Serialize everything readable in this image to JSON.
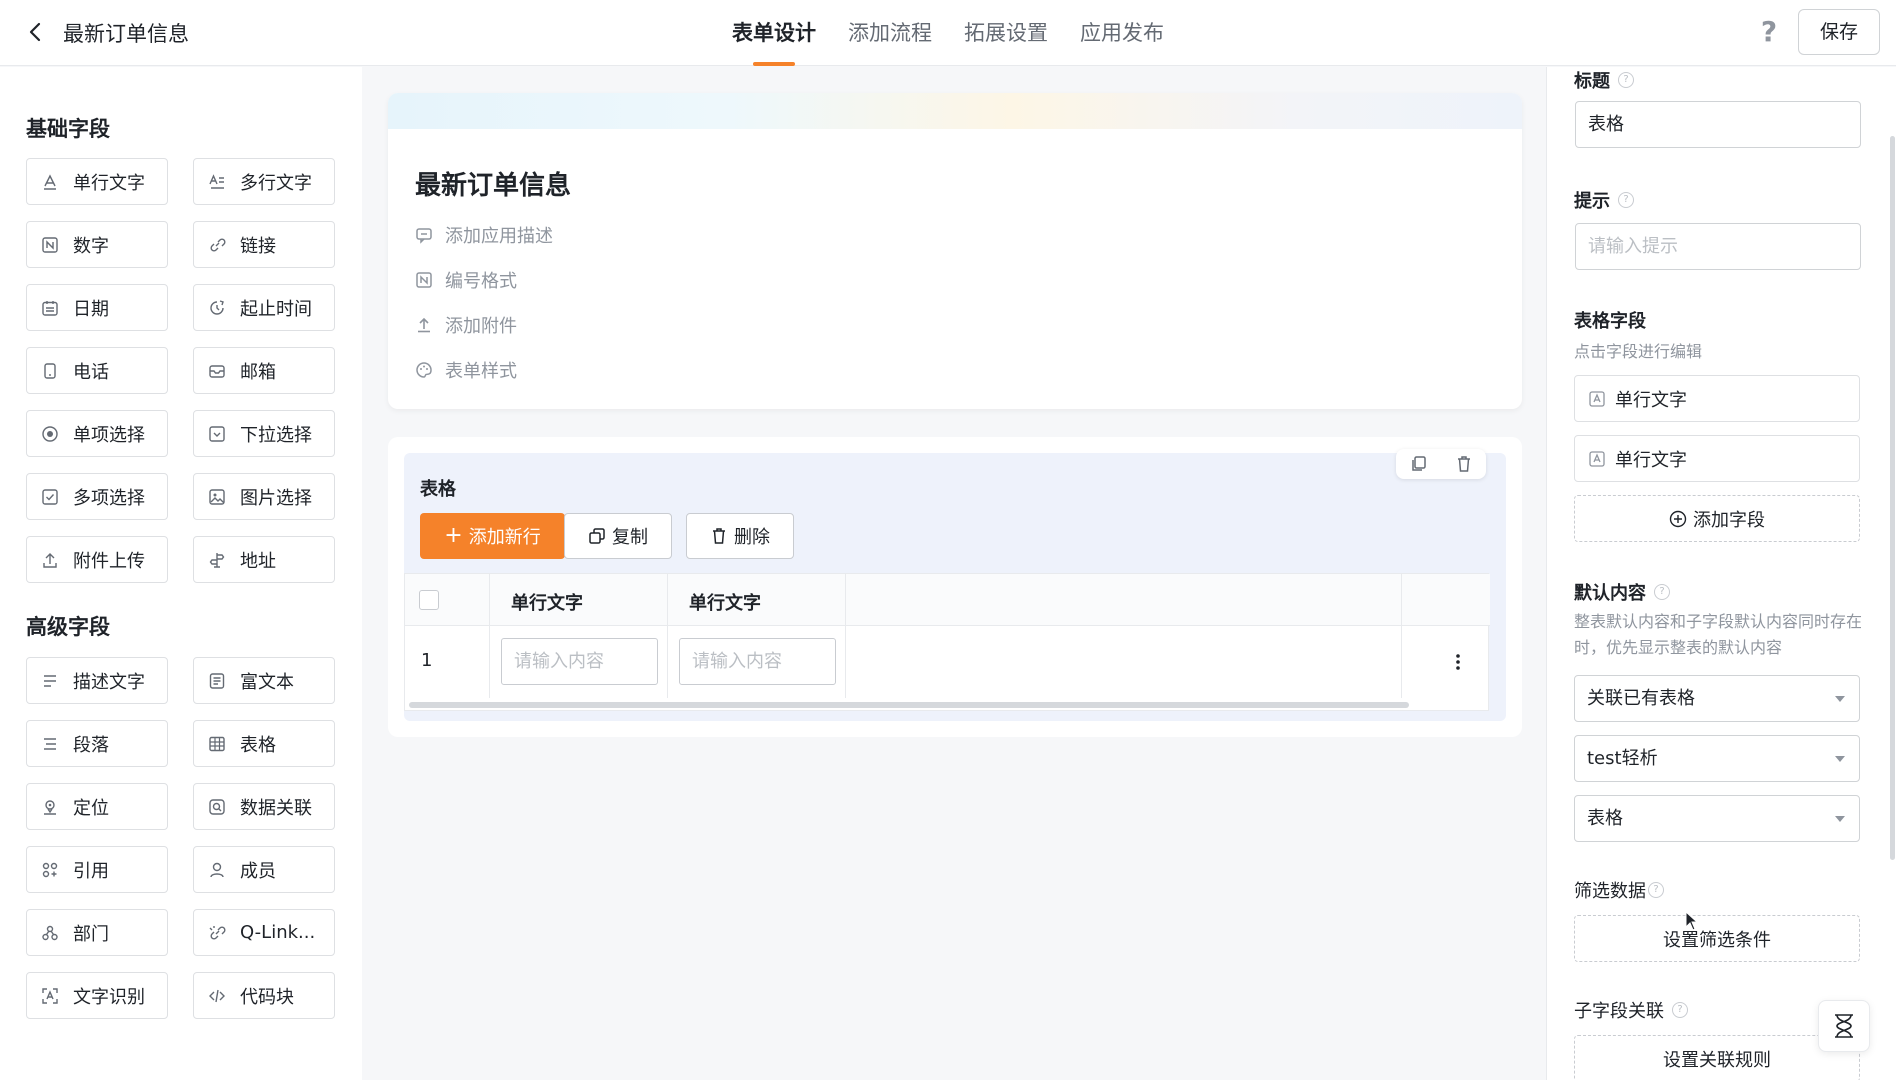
{
  "header": {
    "title": "最新订单信息",
    "tabs": [
      "表单设计",
      "添加流程",
      "拓展设置",
      "应用发布"
    ],
    "help": "?",
    "save": "保存"
  },
  "left": {
    "basic_title": "基础字段",
    "basic_fields": [
      {
        "label": "单行文字",
        "icon": "single-text-icon"
      },
      {
        "label": "多行文字",
        "icon": "multi-text-icon"
      },
      {
        "label": "数字",
        "icon": "number-icon"
      },
      {
        "label": "链接",
        "icon": "link-icon"
      },
      {
        "label": "日期",
        "icon": "calendar-icon"
      },
      {
        "label": "起止时间",
        "icon": "time-range-icon"
      },
      {
        "label": "电话",
        "icon": "phone-icon"
      },
      {
        "label": "邮箱",
        "icon": "mail-icon"
      },
      {
        "label": "单项选择",
        "icon": "radio-icon"
      },
      {
        "label": "下拉选择",
        "icon": "dropdown-icon"
      },
      {
        "label": "多项选择",
        "icon": "checkbox-icon"
      },
      {
        "label": "图片选择",
        "icon": "image-icon"
      },
      {
        "label": "附件上传",
        "icon": "upload-icon"
      },
      {
        "label": "地址",
        "icon": "address-icon"
      }
    ],
    "advanced_title": "高级字段",
    "advanced_fields": [
      {
        "label": "描述文字",
        "icon": "description-icon"
      },
      {
        "label": "富文本",
        "icon": "rich-text-icon"
      },
      {
        "label": "段落",
        "icon": "paragraph-icon"
      },
      {
        "label": "表格",
        "icon": "table-icon"
      },
      {
        "label": "定位",
        "icon": "location-icon"
      },
      {
        "label": "数据关联",
        "icon": "data-link-icon"
      },
      {
        "label": "引用",
        "icon": "reference-icon"
      },
      {
        "label": "成员",
        "icon": "member-icon"
      },
      {
        "label": "部门",
        "icon": "department-icon"
      },
      {
        "label": "Q-Link...",
        "icon": "qlink-icon"
      },
      {
        "label": "文字识别",
        "icon": "ocr-icon"
      },
      {
        "label": "代码块",
        "icon": "code-icon"
      }
    ]
  },
  "form": {
    "title": "最新订单信息",
    "links": [
      "添加应用描述",
      "编号格式",
      "添加附件",
      "表单样式"
    ]
  },
  "table": {
    "title": "表格",
    "add_row": "添加新行",
    "copy": "复制",
    "delete": "删除",
    "columns": [
      "单行文字",
      "单行文字"
    ],
    "row_number": "1",
    "cell_placeholder": "请输入内容"
  },
  "right": {
    "title_label": "标题",
    "title_value": "表格",
    "hint_label": "提示",
    "hint_placeholder": "请输入提示",
    "fields_label": "表格字段",
    "fields_hint": "点击字段进行编辑",
    "fields": [
      "单行文字",
      "单行文字"
    ],
    "add_field": "添加字段",
    "default_label": "默认内容",
    "default_hint": "整表默认内容和子字段默认内容同时存在时，优先显示整表的默认内容",
    "select_mode": "关联已有表格",
    "select_app": "test轻析",
    "select_table": "表格",
    "filter_label": "筛选数据",
    "filter_button": "设置筛选条件",
    "sub_label": "子字段关联",
    "sub_button": "设置关联规则"
  },
  "colors": {
    "accent": "#f5822a",
    "text": "#1f2329",
    "muted": "#8f959e"
  }
}
